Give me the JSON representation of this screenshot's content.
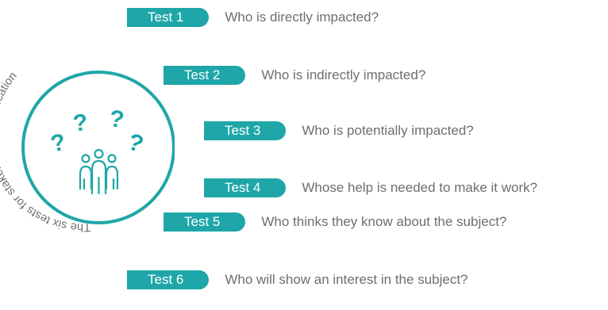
{
  "circle_caption": "The six tests for stakeholder identification",
  "colors": {
    "accent": "#1fa6a8",
    "question_text": "#6e6e6e"
  },
  "icons": {
    "center": "people-group-icon",
    "question_marks": "question-mark-icon"
  },
  "tests": [
    {
      "label": "Test 1",
      "question": "Who is directly impacted?"
    },
    {
      "label": "Test 2",
      "question": "Who is indirectly impacted?"
    },
    {
      "label": "Test 3",
      "question": "Who is potentially impacted?"
    },
    {
      "label": "Test 4",
      "question": "Whose help is needed to make it work?"
    },
    {
      "label": "Test 5",
      "question": "Who thinks they know about the subject?"
    },
    {
      "label": "Test 6",
      "question": "Who will show an interest in the subject?"
    }
  ]
}
